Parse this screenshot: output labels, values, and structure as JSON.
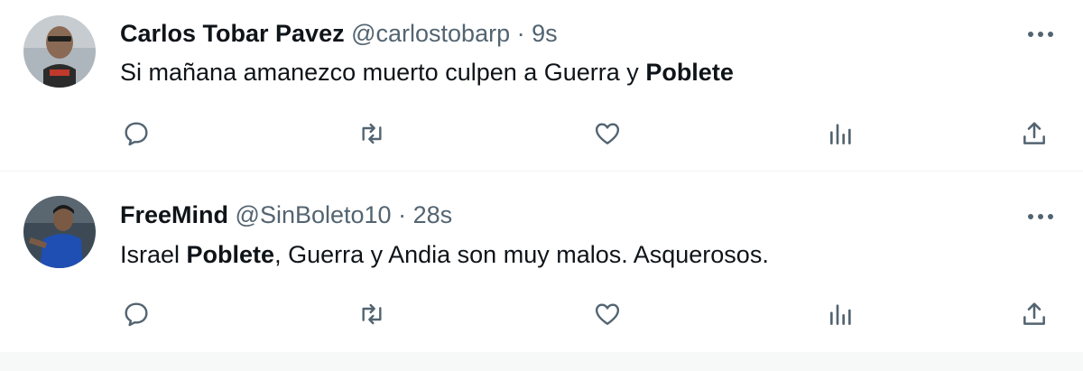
{
  "tweets": [
    {
      "name": "Carlos Tobar Pavez",
      "handle": "@carlostobarp",
      "separator": "·",
      "time": "9s",
      "text_parts": [
        "Si mañana amanezco muerto culpen a Guerra y ",
        "Poblete",
        ""
      ],
      "more_icon": "more-horizontal-icon"
    },
    {
      "name": "FreeMind",
      "handle": "@SinBoleto10",
      "separator": "·",
      "time": "28s",
      "text_parts": [
        "Israel ",
        "Poblete",
        ", Guerra y Andia son muy malos. Asquerosos."
      ],
      "more_icon": "more-horizontal-icon"
    }
  ],
  "icons": {
    "reply": "reply-icon",
    "retweet": "retweet-icon",
    "like": "heart-icon",
    "views": "analytics-icon",
    "share": "share-icon"
  },
  "colors": {
    "text": "#0f1419",
    "secondary": "#536471",
    "icon": "#536471",
    "divider": "#eff3f4"
  }
}
